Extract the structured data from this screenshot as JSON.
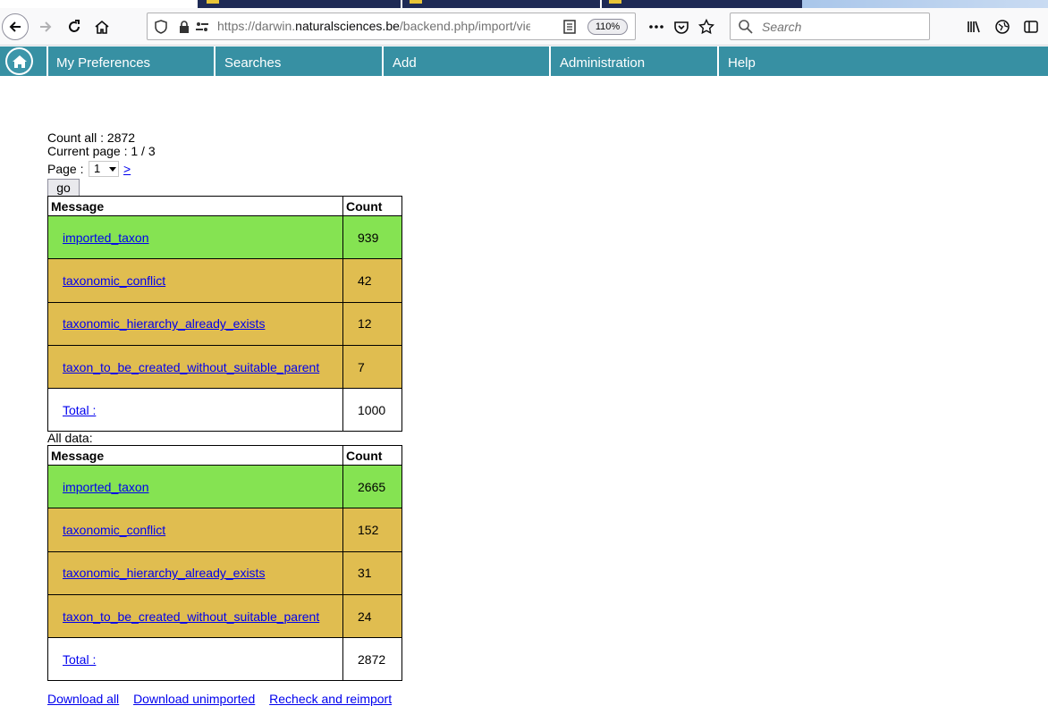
{
  "browser": {
    "url_prefix": "https://darwin.",
    "url_domain": "naturalsciences.be",
    "url_path": "/backend.php/import/vie",
    "zoom": "110%",
    "search_placeholder": "Search",
    "colors": {
      "tab_dark": "#1e2a55",
      "toolbar": "#f9f9fa"
    }
  },
  "nav": {
    "items": [
      {
        "label": "My Preferences"
      },
      {
        "label": "Searches"
      },
      {
        "label": "Add"
      },
      {
        "label": "Administration"
      },
      {
        "label": "Help"
      }
    ],
    "color": "#3790a3"
  },
  "summary": {
    "count_all": "Count all : 2872",
    "current_page": "Current page : 1 / 3",
    "page_label": "Page :",
    "page_value": "1",
    "next_label": ">",
    "go_label": "go"
  },
  "page_table": {
    "headers": [
      "Message",
      "Count"
    ],
    "rows": [
      {
        "message": "imported_taxon",
        "count": "939",
        "status": "ok"
      },
      {
        "message": "taxonomic_conflict",
        "count": "42",
        "status": "warn"
      },
      {
        "message": "taxonomic_hierarchy_already_exists",
        "count": "12",
        "status": "warn"
      },
      {
        "message": "taxon_to_be_created_without_suitable_parent",
        "count": "7",
        "status": "warn"
      },
      {
        "message": "Total :",
        "count": "1000",
        "status": "total"
      }
    ]
  },
  "all_data_label": "All data:",
  "all_table": {
    "headers": [
      "Message",
      "Count"
    ],
    "rows": [
      {
        "message": "imported_taxon",
        "count": "2665",
        "status": "ok"
      },
      {
        "message": "taxonomic_conflict",
        "count": "152",
        "status": "warn"
      },
      {
        "message": "taxonomic_hierarchy_already_exists",
        "count": "31",
        "status": "warn"
      },
      {
        "message": "taxon_to_be_created_without_suitable_parent",
        "count": "24",
        "status": "warn"
      },
      {
        "message": "Total :",
        "count": "2872",
        "status": "total"
      }
    ]
  },
  "footer": {
    "links": [
      "Download all",
      "Download unimported",
      "Recheck and reimport"
    ]
  },
  "status_colors": {
    "ok": "#85e352",
    "warn": "#e0bd50",
    "total": "#ffffff"
  }
}
